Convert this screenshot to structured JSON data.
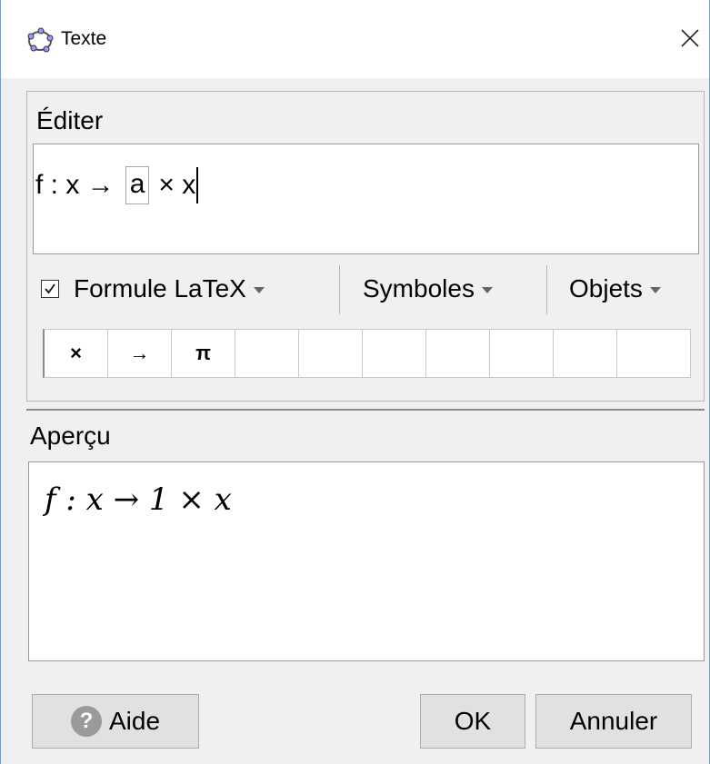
{
  "window": {
    "title": "Texte",
    "close_glyph": "✕"
  },
  "edit": {
    "label": "Éditer",
    "formula_prefix": "f : x → ",
    "formula_placeholder": "a",
    "formula_suffix": "× x"
  },
  "toolbar": {
    "latex_checked": true,
    "latex_label": "Formule LaTeX",
    "symbols_label": "Symboles",
    "objects_label": "Objets"
  },
  "symbols": [
    "×",
    "→",
    "π",
    "",
    "",
    "",
    "",
    "",
    "",
    ""
  ],
  "preview": {
    "label": "Aperçu",
    "rendered": "f : x → 1 × x"
  },
  "buttons": {
    "help": "Aide",
    "help_icon": "?",
    "ok": "OK",
    "cancel": "Annuler"
  },
  "icons": {
    "title": "geogebra-icon",
    "close": "close-icon",
    "help": "help-icon",
    "dropdown": "chevron-down-icon"
  }
}
